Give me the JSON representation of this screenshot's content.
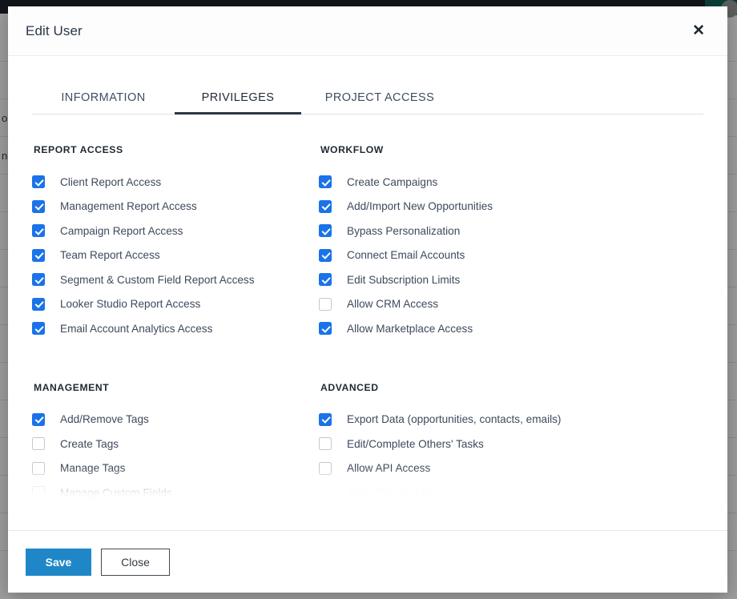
{
  "background": {
    "rows": [
      {
        "text": ""
      },
      {
        "text": ""
      },
      {
        "text": "oi"
      },
      {
        "text": "ne"
      },
      {
        "text": ""
      },
      {
        "text": ""
      },
      {
        "text": ""
      },
      {
        "text": ""
      },
      {
        "text": ""
      },
      {
        "text": ""
      },
      {
        "text": ""
      },
      {
        "text": ""
      },
      {
        "text": ""
      },
      {
        "text": ""
      }
    ],
    "topbar_color": "#1d252d",
    "accent_teal": "#11695b"
  },
  "modal": {
    "title": "Edit User",
    "close_label": "✕",
    "tabs": [
      {
        "id": "information",
        "label": "INFORMATION",
        "active": false
      },
      {
        "id": "privileges",
        "label": "PRIVILEGES",
        "active": true
      },
      {
        "id": "project-access",
        "label": "PROJECT ACCESS",
        "active": false
      }
    ],
    "sections": [
      {
        "id": "report-access",
        "title": "REPORT ACCESS",
        "column": "left",
        "row": 1,
        "items": [
          {
            "label": "Client Report Access",
            "checked": true,
            "faded": false
          },
          {
            "label": "Management Report Access",
            "checked": true,
            "faded": false
          },
          {
            "label": "Campaign Report Access",
            "checked": true,
            "faded": false
          },
          {
            "label": "Team Report Access",
            "checked": true,
            "faded": false
          },
          {
            "label": "Segment & Custom Field Report Access",
            "checked": true,
            "faded": false
          },
          {
            "label": "Looker Studio Report Access",
            "checked": true,
            "faded": false
          },
          {
            "label": "Email Account Analytics Access",
            "checked": true,
            "faded": false
          }
        ]
      },
      {
        "id": "workflow",
        "title": "WORKFLOW",
        "column": "right",
        "row": 1,
        "items": [
          {
            "label": "Create Campaigns",
            "checked": true,
            "faded": false
          },
          {
            "label": "Add/Import New Opportunities",
            "checked": true,
            "faded": false
          },
          {
            "label": "Bypass Personalization",
            "checked": true,
            "faded": false
          },
          {
            "label": "Connect Email Accounts",
            "checked": true,
            "faded": false
          },
          {
            "label": "Edit Subscription Limits",
            "checked": true,
            "faded": false
          },
          {
            "label": "Allow CRM Access",
            "checked": false,
            "faded": false
          },
          {
            "label": "Allow Marketplace Access",
            "checked": true,
            "faded": false
          }
        ]
      },
      {
        "id": "management",
        "title": "MANAGEMENT",
        "column": "left",
        "row": 2,
        "items": [
          {
            "label": "Add/Remove Tags",
            "checked": true,
            "faded": false
          },
          {
            "label": "Create Tags",
            "checked": false,
            "faded": false
          },
          {
            "label": "Manage Tags",
            "checked": false,
            "faded": false
          },
          {
            "label": "Manage Custom Fields",
            "checked": false,
            "faded": false
          }
        ]
      },
      {
        "id": "advanced",
        "title": "ADVANCED",
        "column": "right",
        "row": 2,
        "items": [
          {
            "label": "Export Data (opportunities, contacts, emails)",
            "checked": true,
            "faded": false
          },
          {
            "label": "Edit/Complete Others' Tasks",
            "checked": false,
            "faded": false
          },
          {
            "label": "Allow API Access",
            "checked": false,
            "faded": false
          },
          {
            "label": "Allow Prospect AI Access",
            "checked": false,
            "faded": true
          }
        ]
      }
    ],
    "footer": {
      "save_label": "Save",
      "close_label": "Close"
    }
  },
  "colors": {
    "checkbox_checked": "#1a73e8",
    "save_button": "#1f87c7",
    "active_tab_underline": "#2b3746"
  }
}
